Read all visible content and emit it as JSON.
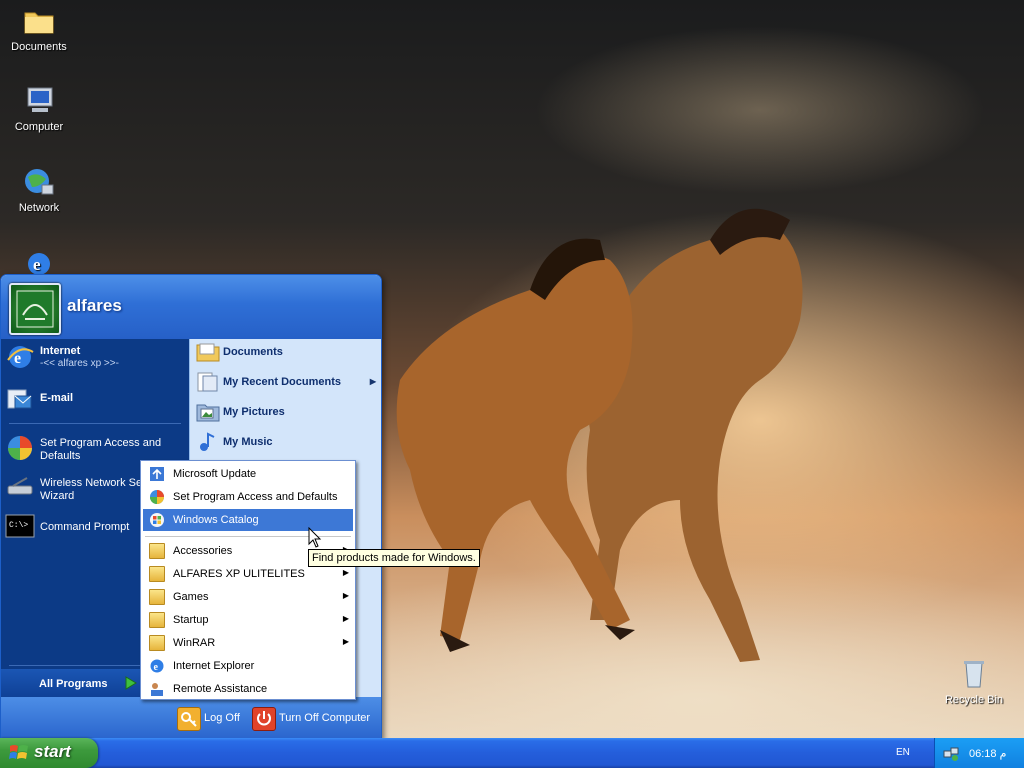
{
  "desktop": {
    "icons": [
      {
        "label": "Documents",
        "icon": "folder-icon"
      },
      {
        "label": "Computer",
        "icon": "computer-icon"
      },
      {
        "label": "Network",
        "icon": "network-icon"
      },
      {
        "label": "",
        "icon": "internet-explorer-icon"
      },
      {
        "label": "Recycle Bin",
        "icon": "recycle-bin-icon"
      }
    ]
  },
  "start_menu": {
    "username": "alfares",
    "left_items": [
      {
        "title": "Internet",
        "subtitle": "-<< alfares xp >>-",
        "icon": "internet-explorer-icon"
      },
      {
        "title": "E-mail",
        "icon": "email-icon"
      },
      {
        "title": "Set Program Access and Defaults",
        "icon": "program-access-icon"
      },
      {
        "title": "Wireless Network Setup Wizard",
        "icon": "wireless-icon"
      },
      {
        "title": "Command Prompt",
        "icon": "command-prompt-icon"
      }
    ],
    "left_lines": {
      "spad_1": "Set Program Access and",
      "spad_2": "Defaults",
      "wireless_1": "Wireless Network Se",
      "wireless_2": "Wizard"
    },
    "all_programs": "All Programs",
    "right_items": [
      {
        "label": "Documents",
        "icon": "documents-folder-icon",
        "arrow": false
      },
      {
        "label": "My Recent Documents",
        "icon": "recent-documents-icon",
        "arrow": true
      },
      {
        "label": "My Pictures",
        "icon": "pictures-icon",
        "arrow": false
      },
      {
        "label": "My Music",
        "icon": "music-icon",
        "arrow": false
      }
    ],
    "footer": {
      "log_off": "Log Off",
      "turn_off": "Turn Off Computer"
    }
  },
  "programs_submenu": {
    "items": [
      {
        "label": "Microsoft Update",
        "icon": "windows-update-icon",
        "arrow": false
      },
      {
        "label": "Set Program Access and Defaults",
        "icon": "program-access-icon",
        "arrow": false
      },
      {
        "label": "Windows Catalog",
        "icon": "windows-catalog-icon",
        "arrow": false,
        "highlighted": true
      },
      {
        "label": "Accessories",
        "icon": "folder-icon",
        "arrow": true
      },
      {
        "label": "ALFARES XP ULITELITES",
        "icon": "folder-icon",
        "arrow": true
      },
      {
        "label": "Games",
        "icon": "folder-icon",
        "arrow": true
      },
      {
        "label": "Startup",
        "icon": "folder-icon",
        "arrow": true
      },
      {
        "label": "WinRAR",
        "icon": "folder-icon",
        "arrow": true
      },
      {
        "label": "Internet Explorer",
        "icon": "internet-explorer-icon",
        "arrow": false
      },
      {
        "label": "Remote Assistance",
        "icon": "remote-assistance-icon",
        "arrow": false
      }
    ]
  },
  "tooltip": "Find products made for Windows.",
  "taskbar": {
    "start_label": "start",
    "language": "EN",
    "clock": "06:18 م"
  },
  "colors": {
    "taskbar_blue": "#245edb",
    "start_green": "#3d9a3d",
    "menu_left_blue": "#0c3a86",
    "menu_right_blue": "#d3e5fa",
    "highlight": "#3d78d6"
  }
}
